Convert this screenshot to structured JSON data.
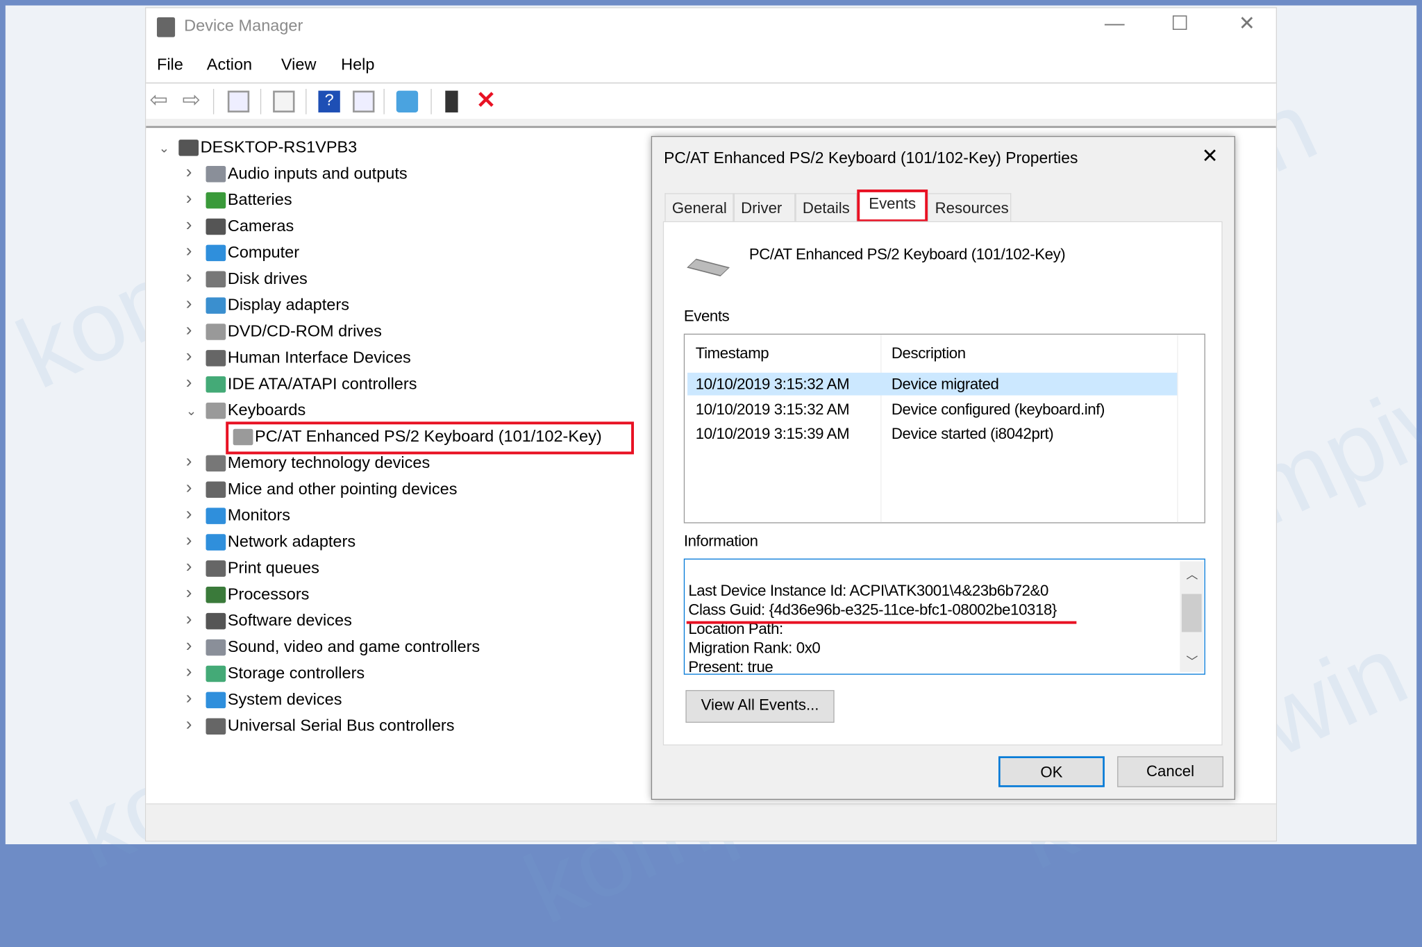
{
  "window": {
    "title": "Device Manager",
    "minimize": "—",
    "maximize": "☐",
    "close": "✕"
  },
  "menu": [
    "File",
    "Action",
    "View",
    "Help"
  ],
  "toolbar": [
    "back-icon",
    "forward-icon",
    "show-hide-tree-icon",
    "properties-icon",
    "help-icon",
    "action-pane-icon",
    "scan-hardware-icon",
    "update-driver-icon",
    "uninstall-icon"
  ],
  "tree": {
    "root": "DESKTOP-RS1VPB3",
    "items": [
      {
        "label": "Audio inputs and outputs",
        "icon": "speaker-icon",
        "color": "#8a8f99"
      },
      {
        "label": "Batteries",
        "icon": "battery-icon",
        "color": "#3a9a3a"
      },
      {
        "label": "Cameras",
        "icon": "camera-icon",
        "color": "#555"
      },
      {
        "label": "Computer",
        "icon": "computer-icon",
        "color": "#2f8fdc"
      },
      {
        "label": "Disk drives",
        "icon": "disk-icon",
        "color": "#777"
      },
      {
        "label": "Display adapters",
        "icon": "display-adapter-icon",
        "color": "#3a8fcf"
      },
      {
        "label": "DVD/CD-ROM drives",
        "icon": "dvd-icon",
        "color": "#999"
      },
      {
        "label": "Human Interface Devices",
        "icon": "hid-icon",
        "color": "#666"
      },
      {
        "label": "IDE ATA/ATAPI controllers",
        "icon": "ide-icon",
        "color": "#4a7"
      },
      {
        "label": "Keyboards",
        "icon": "keyboard-icon",
        "color": "#9a9a9a",
        "expanded": true,
        "children": [
          {
            "label": "PC/AT Enhanced PS/2 Keyboard (101/102-Key)",
            "icon": "keyboard-icon",
            "color": "#9a9a9a",
            "highlighted": true
          }
        ]
      },
      {
        "label": "Memory technology devices",
        "icon": "memory-icon",
        "color": "#777"
      },
      {
        "label": "Mice and other pointing devices",
        "icon": "mouse-icon",
        "color": "#666"
      },
      {
        "label": "Monitors",
        "icon": "monitor-icon",
        "color": "#2f8fdc"
      },
      {
        "label": "Network adapters",
        "icon": "network-icon",
        "color": "#2f8fdc"
      },
      {
        "label": "Print queues",
        "icon": "printer-icon",
        "color": "#666"
      },
      {
        "label": "Processors",
        "icon": "processor-icon",
        "color": "#3a7a3a"
      },
      {
        "label": "Software devices",
        "icon": "software-device-icon",
        "color": "#555"
      },
      {
        "label": "Sound, video and game controllers",
        "icon": "sound-icon",
        "color": "#8a8f99"
      },
      {
        "label": "Storage controllers",
        "icon": "storage-icon",
        "color": "#4a7"
      },
      {
        "label": "System devices",
        "icon": "system-icon",
        "color": "#2f8fdc"
      },
      {
        "label": "Universal Serial Bus controllers",
        "icon": "usb-icon",
        "color": "#666"
      }
    ]
  },
  "dialog": {
    "title": "PC/AT Enhanced PS/2 Keyboard (101/102-Key) Properties",
    "close": "✕",
    "tabs": [
      "General",
      "Driver",
      "Details",
      "Events",
      "Resources"
    ],
    "active_tab": "Events",
    "device_name": "PC/AT Enhanced PS/2 Keyboard (101/102-Key)",
    "events_label": "Events",
    "columns": [
      "Timestamp",
      "Description"
    ],
    "events": [
      {
        "timestamp": "10/10/2019 3:15:32 AM",
        "description": "Device migrated",
        "selected": true
      },
      {
        "timestamp": "10/10/2019 3:15:32 AM",
        "description": "Device configured (keyboard.inf)"
      },
      {
        "timestamp": "10/10/2019 3:15:39 AM",
        "description": "Device started (i8042prt)"
      }
    ],
    "information_label": "Information",
    "information": [
      "Last Device Instance Id: ACPI\\ATK3001\\4&23b6b72&0",
      "Class Guid: {4d36e96b-e325-11ce-bfc1-08002be10318}",
      "Location Path:",
      "Migration Rank: 0x0",
      "Present: true"
    ],
    "view_all": "View All Events...",
    "ok": "OK",
    "cancel": "Cancel"
  },
  "watermark": "kompiwin",
  "colors": {
    "highlight": "#e81123",
    "accent": "#0078d7",
    "selection": "#cce8ff"
  }
}
